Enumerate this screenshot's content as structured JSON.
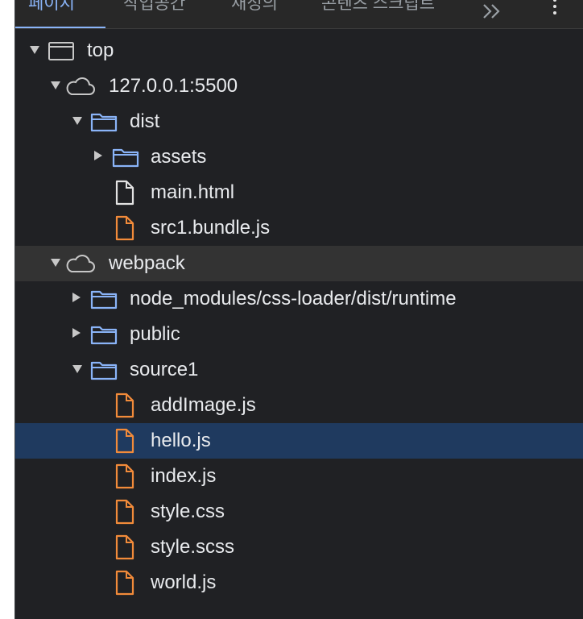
{
  "tabs": [
    {
      "label": "페이지",
      "active": true
    },
    {
      "label": "작업공간",
      "active": false
    },
    {
      "label": "재정의",
      "active": false
    },
    {
      "label": "콘텐츠 스크립트",
      "active": false
    }
  ],
  "more_tabs": "»",
  "tree": [
    {
      "label": "top",
      "icon": "frame-icon",
      "level": 0,
      "expand": "down"
    },
    {
      "label": "127.0.0.1:5500",
      "icon": "cloud-icon",
      "level": 1,
      "expand": "down"
    },
    {
      "label": "dist",
      "icon": "folder-icon",
      "level": 2,
      "expand": "down"
    },
    {
      "label": "assets",
      "icon": "folder-icon",
      "level": 3,
      "expand": "right"
    },
    {
      "label": "main.html",
      "icon": "file-icon",
      "level": 3,
      "expand": "none",
      "file_color": "#e3e3e3"
    },
    {
      "label": "src1.bundle.js",
      "icon": "file-icon",
      "level": 3,
      "expand": "none",
      "file_color": "#f28b3a"
    },
    {
      "label": "webpack",
      "icon": "cloud-icon",
      "level": 1,
      "expand": "down",
      "state": "hover"
    },
    {
      "label": "node_modules/css-loader/dist/runtime",
      "icon": "folder-icon",
      "level": 2,
      "expand": "right"
    },
    {
      "label": "public",
      "icon": "folder-icon",
      "level": 2,
      "expand": "right"
    },
    {
      "label": "source1",
      "icon": "folder-icon",
      "level": 2,
      "expand": "down"
    },
    {
      "label": "addImage.js",
      "icon": "file-icon",
      "level": 3,
      "expand": "none",
      "file_color": "#f28b3a"
    },
    {
      "label": "hello.js",
      "icon": "file-icon",
      "level": 3,
      "expand": "none",
      "file_color": "#f28b3a",
      "state": "selected"
    },
    {
      "label": "index.js",
      "icon": "file-icon",
      "level": 3,
      "expand": "none",
      "file_color": "#f28b3a"
    },
    {
      "label": "style.css",
      "icon": "file-icon",
      "level": 3,
      "expand": "none",
      "file_color": "#f28b3a"
    },
    {
      "label": "style.scss",
      "icon": "file-icon",
      "level": 3,
      "expand": "none",
      "file_color": "#f28b3a"
    },
    {
      "label": "world.js",
      "icon": "file-icon",
      "level": 3,
      "expand": "none",
      "file_color": "#f28b3a"
    }
  ],
  "colors": {
    "accent": "#8ab4f8",
    "folder": "#8ab4f8",
    "js_file": "#f28b3a",
    "selected_bg": "#1f3a5f",
    "hover_bg": "#333333"
  }
}
